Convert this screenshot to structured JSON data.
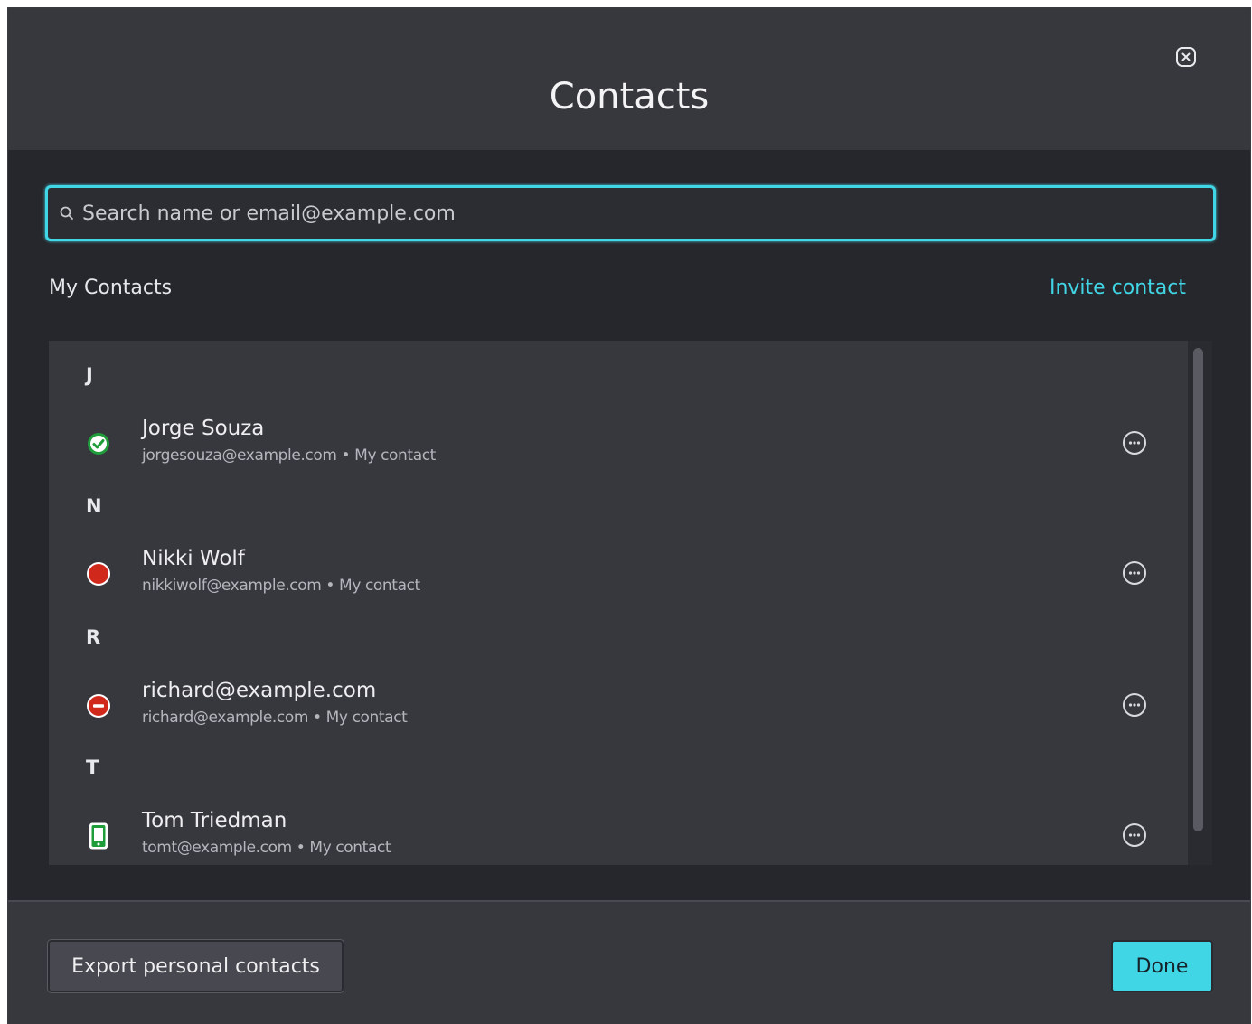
{
  "dialog": {
    "title": "Contacts",
    "close_icon": "close-icon"
  },
  "search": {
    "placeholder": "Search name or email@example.com",
    "value": "",
    "icon": "search-icon"
  },
  "section": {
    "label": "My Contacts",
    "invite_label": "Invite contact"
  },
  "groups": [
    {
      "letter": "J",
      "contact": {
        "name": "Jorge Souza",
        "email": "jorgesouza@example.com",
        "tag": "My contact",
        "status": "available-icon"
      }
    },
    {
      "letter": "N",
      "contact": {
        "name": "Nikki Wolf",
        "email": "nikkiwolf@example.com",
        "tag": "My contact",
        "status": "busy-icon"
      }
    },
    {
      "letter": "R",
      "contact": {
        "name": "richard@example.com",
        "email": "richard@example.com",
        "tag": "My contact",
        "status": "do-not-disturb-icon"
      }
    },
    {
      "letter": "T",
      "contact": {
        "name": "Tom Triedman",
        "email": "tomt@example.com",
        "tag": "My contact",
        "status": "mobile-icon"
      }
    }
  ],
  "separator": " • ",
  "footer": {
    "export_label": "Export personal contacts",
    "done_label": "Done"
  },
  "colors": {
    "accent": "#41d6e6",
    "available": "#1f9d3b",
    "busy": "#d1281c",
    "mobile": "#1f9d3b"
  }
}
